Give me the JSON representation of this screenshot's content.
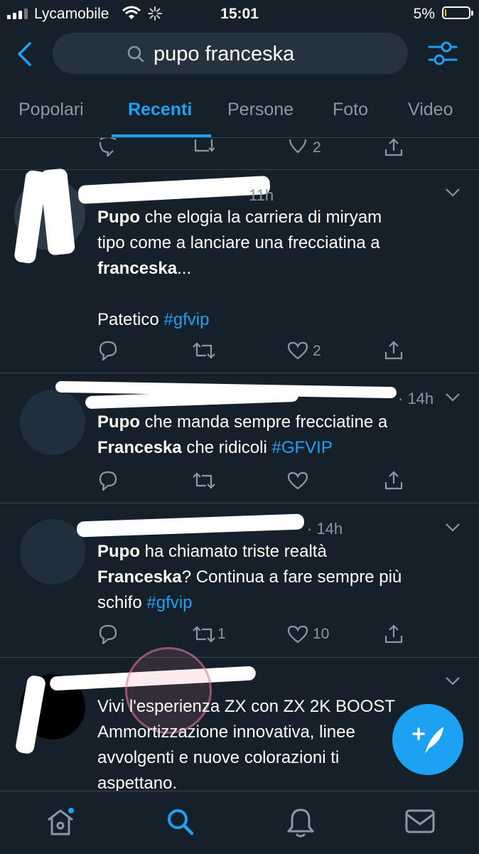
{
  "status_bar": {
    "carrier": "Lycamobile",
    "time": "15:01",
    "battery": "5%",
    "battery_level": 0.05
  },
  "search": {
    "query": "pupo franceska"
  },
  "tabs": [
    {
      "label": "Popolari"
    },
    {
      "label": "Recenti"
    },
    {
      "label": "Persone"
    },
    {
      "label": "Foto"
    },
    {
      "label": "Video"
    }
  ],
  "top_actions": {
    "likes": "2"
  },
  "tweets": [
    {
      "time": "11h",
      "line1_bold": "Pupo",
      "line1": " che elogia la carriera di miryam",
      "line2": "tipo come a lanciare una frecciatina a",
      "line3_bold": "franceska",
      "line3": "...",
      "line4": "Patetico ",
      "hashtag": "#gfvip",
      "likes": "2"
    },
    {
      "time": "· 14h",
      "line1_bold": "Pupo",
      "line1": " che manda sempre frecciatine a",
      "line2_bold": "Franceska",
      "line2": " che ridicoli ",
      "hashtag": "#GFVIP"
    },
    {
      "time": "· 14h",
      "line1_bold": "Pupo",
      "line1": " ha chiamato triste realtà",
      "line2_bold": "Franceska",
      "line2": "? Continua a fare sempre più",
      "line3": "schifo ",
      "hashtag": "#gfvip",
      "retweets": "1",
      "likes": "10"
    },
    {
      "line1": "Vivi l'esperienza ZX con ZX 2K BOOST",
      "line2": "Ammortizzazione innovativa, linee",
      "line3": "avvolgenti e nuove colorazioni ti",
      "line4": "aspettano."
    }
  ],
  "colors": {
    "background": "#15202b",
    "accent": "#1da1f2",
    "muted": "#8899a6",
    "divider": "#38444d"
  },
  "icons": [
    "back-icon",
    "search-icon",
    "filter-icon",
    "reply-icon",
    "retweet-icon",
    "like-icon",
    "share-icon",
    "chevron-down-icon",
    "compose-icon",
    "home-icon",
    "bell-icon",
    "mail-icon"
  ]
}
